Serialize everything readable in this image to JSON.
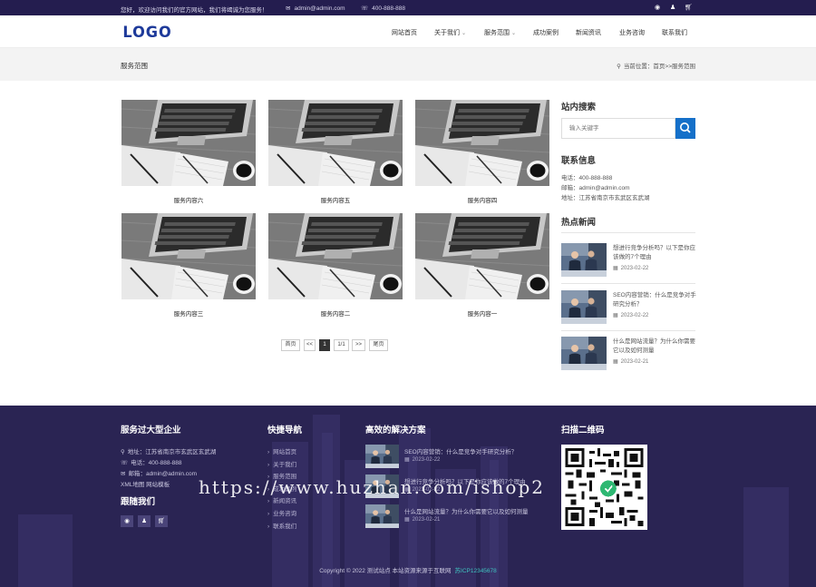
{
  "topbar": {
    "welcome": "您好，欢迎访问我们的官方网站，我们将竭诚为您服务！",
    "email": "admin@admin.com",
    "phone": "400-888-888",
    "icons": [
      "weibo-icon",
      "qq-icon",
      "cart-icon"
    ]
  },
  "header": {
    "logo": "LOGO",
    "nav": [
      {
        "label": "网站首页"
      },
      {
        "label": "关于我们",
        "has_dropdown": true
      },
      {
        "label": "服务范围",
        "has_dropdown": true
      },
      {
        "label": "成功案例"
      },
      {
        "label": "新闻资讯"
      },
      {
        "label": "业务咨询"
      },
      {
        "label": "联系我们"
      }
    ]
  },
  "breadcrumb": {
    "page_title": "服务范围",
    "location": "当前位置：首页>>服务范围"
  },
  "services": [
    {
      "label": "服务内容六"
    },
    {
      "label": "服务内容五"
    },
    {
      "label": "服务内容四"
    },
    {
      "label": "服务内容三"
    },
    {
      "label": "服务内容二"
    },
    {
      "label": "服务内容一"
    }
  ],
  "pagination": {
    "first": "首页",
    "prev": "<<",
    "current": "1",
    "info": "1/1",
    "next": ">>",
    "last": "尾页"
  },
  "sidebar": {
    "search_title": "站内搜索",
    "search_placeholder": "输入关键字",
    "contact_title": "联系信息",
    "contact": {
      "phone": "电话：400-888-888",
      "email": "邮箱：admin@admin.com",
      "address": "地址：江苏省南京市玄武区玄武湖"
    },
    "news_title": "热点新闻",
    "news": [
      {
        "title": "想进行竞争分析吗？以下是你应该做的7个理由",
        "date": "2023-02-22"
      },
      {
        "title": "SEO内容营销：什么是竞争对手研究分析？",
        "date": "2023-02-22"
      },
      {
        "title": "什么是网站流量？为什么你需要它以及如何测量",
        "date": "2023-02-21"
      }
    ]
  },
  "footer": {
    "company_title": "服务过大型企业",
    "address": "地址：江苏省南京市玄武区玄武湖",
    "phone": "电话：400-888-888",
    "email": "邮箱：admin@admin.com",
    "sitemap": "XML地图 网站模板",
    "follow_title": "跟随我们",
    "links_title": "快捷导航",
    "links": [
      "网站首页",
      "关于我们",
      "服务范围",
      "成功案例",
      "新闻资讯",
      "业务咨询",
      "联系我们"
    ],
    "solutions_title": "高效的解决方案",
    "solutions": [
      {
        "title": "SEO内容营销：什么是竞争对手研究分析？",
        "date": "2023-02-22"
      },
      {
        "title": "想进行竞争分析吗？以下是你应该做的7个理由",
        "date": "2023-02-22"
      },
      {
        "title": "什么是网站流量？为什么你需要它以及如何测量",
        "date": "2023-02-21"
      }
    ],
    "qr_title": "扫描二维码",
    "copyright": "Copyright © 2022 测试站点 本站资源来源于互联网",
    "beian": "苏ICP12345678"
  },
  "watermark": "https://www.huzhan.com/ishop2"
}
